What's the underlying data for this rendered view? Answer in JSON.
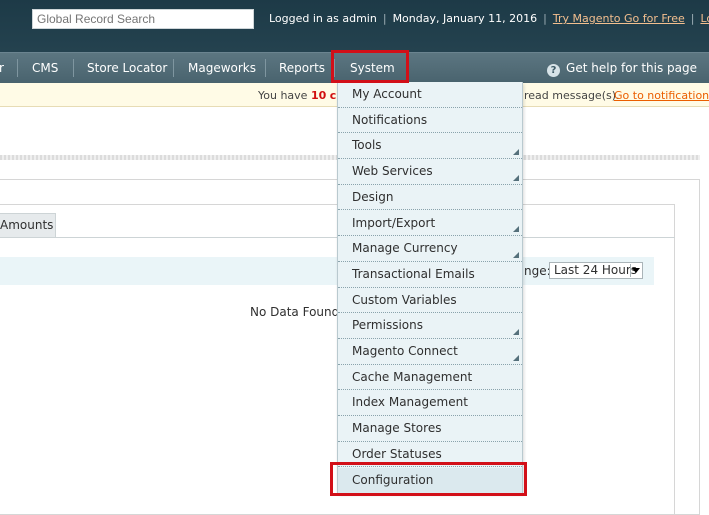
{
  "header": {
    "search_placeholder": "Global Record Search",
    "logged_in": "Logged in as admin",
    "date": "Monday, January 11, 2016",
    "try_link": "Try Magento Go for Free",
    "logout_link": "Log Out"
  },
  "nav": {
    "items": [
      {
        "label": "r"
      },
      {
        "label": "CMS"
      },
      {
        "label": "Store Locator"
      },
      {
        "label": "Mageworks"
      },
      {
        "label": "Reports"
      },
      {
        "label": "System"
      }
    ],
    "help": "Get help for this page"
  },
  "notice": {
    "prefix": "You have",
    "count": "10",
    "fragment": "criti",
    "suffix": "read message(s).",
    "link": "Go to notifications"
  },
  "content": {
    "tab_label": "Amounts",
    "range_label": "nge:",
    "range_value": "Last 24 Hours",
    "no_data": "No Data Found"
  },
  "menu": {
    "items": [
      {
        "label": "My Account",
        "has_submenu": false
      },
      {
        "label": "Notifications",
        "has_submenu": false
      },
      {
        "label": "Tools",
        "has_submenu": true
      },
      {
        "label": "Web Services",
        "has_submenu": true
      },
      {
        "label": "Design",
        "has_submenu": false
      },
      {
        "label": "Import/Export",
        "has_submenu": true
      },
      {
        "label": "Manage Currency",
        "has_submenu": true
      },
      {
        "label": "Transactional Emails",
        "has_submenu": false
      },
      {
        "label": "Custom Variables",
        "has_submenu": false
      },
      {
        "label": "Permissions",
        "has_submenu": true
      },
      {
        "label": "Magento Connect",
        "has_submenu": true
      },
      {
        "label": "Cache Management",
        "has_submenu": false
      },
      {
        "label": "Index Management",
        "has_submenu": false
      },
      {
        "label": "Manage Stores",
        "has_submenu": false
      },
      {
        "label": "Order Statuses",
        "has_submenu": false
      },
      {
        "label": "Configuration",
        "has_submenu": false
      }
    ]
  },
  "colors": {
    "highlight": "#d20f18",
    "header_bg": "#1d3a47",
    "nav_bg": "#4f6a75",
    "menu_bg": "#eaf3f6",
    "link_orange": "#eb5e00"
  }
}
